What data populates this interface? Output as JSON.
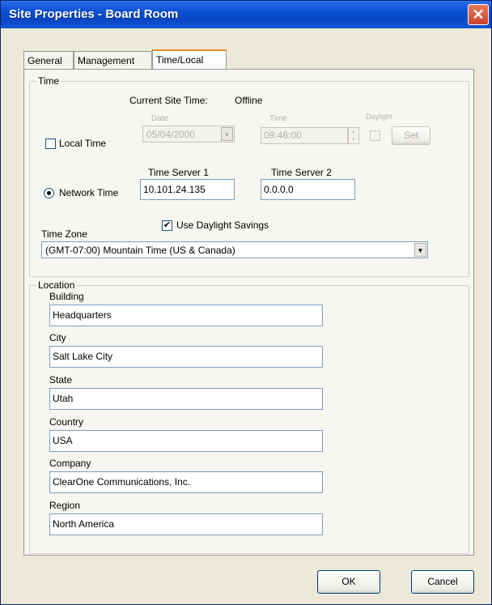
{
  "window": {
    "title": "Site Properties - Board Room",
    "close_glyph": "✕"
  },
  "tabs": [
    {
      "label": "General"
    },
    {
      "label": "Management"
    },
    {
      "label": "Time/Local"
    }
  ],
  "time": {
    "legend": "Time",
    "current_site_time_label": "Current Site Time:",
    "current_site_time_value": "Offline",
    "local_time": {
      "label": "Local Time",
      "checked": false,
      "check_glyph": "",
      "date_caption": "Date",
      "date_value": "05/04/2000",
      "time_caption": "Time",
      "time_value": "09:46:00",
      "small_caption": "Daylight",
      "set_button": "Set"
    },
    "network_time": {
      "label": "Network Time",
      "selected": true,
      "server1_label": "Time Server 1",
      "server1_value": "10.101.24.135",
      "server2_label": "Time Server 2",
      "server2_value": "0.0.0.0"
    },
    "daylight_savings": {
      "label": "Use Daylight Savings",
      "checked": true,
      "check_glyph": "✔"
    },
    "time_zone": {
      "label": "Time Zone",
      "value": "(GMT-07:00) Mountain Time (US & Canada)",
      "arrow_glyph": "▼"
    }
  },
  "location": {
    "legend": "Location",
    "fields": [
      {
        "label": "Building",
        "value": "Headquarters"
      },
      {
        "label": "City",
        "value": "Salt Lake City"
      },
      {
        "label": "State",
        "value": "Utah"
      },
      {
        "label": "Country",
        "value": "USA"
      },
      {
        "label": "Company",
        "value": "ClearOne Communications, Inc."
      },
      {
        "label": "Region",
        "value": "North America"
      }
    ]
  },
  "buttons": {
    "ok": "OK",
    "cancel": "Cancel"
  }
}
